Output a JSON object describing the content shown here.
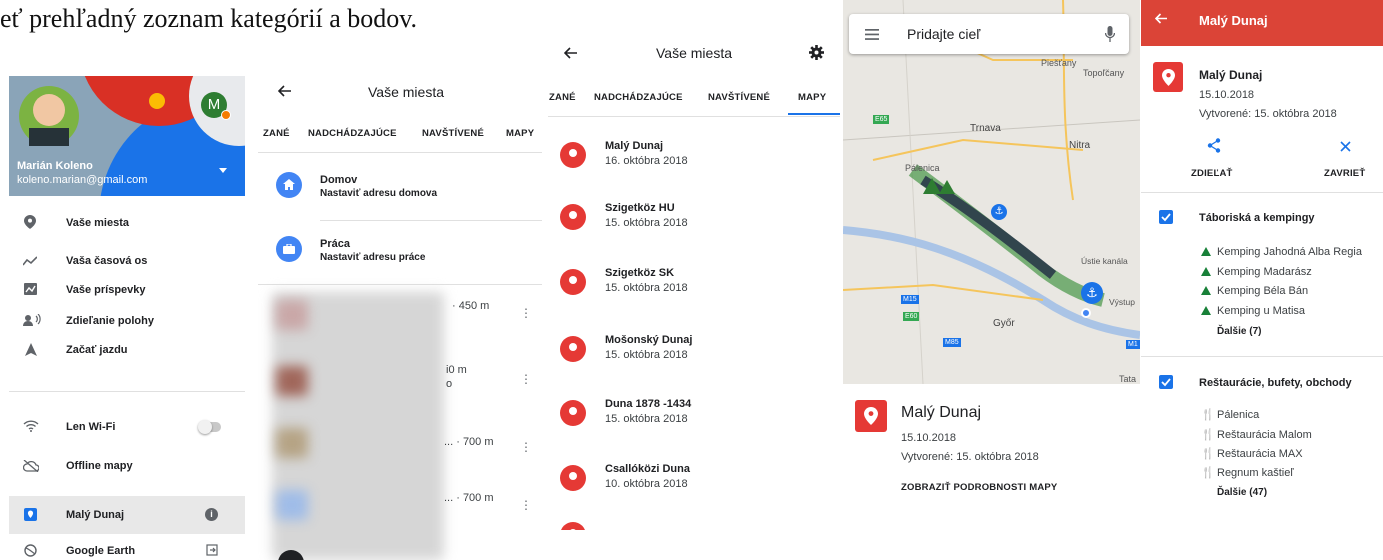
{
  "heading": {
    "text": "eť prehľadný zoznam kategórií a bodov."
  },
  "panel1": {
    "user_name": "Marián Koleno",
    "user_email": "koleno.marian@gmail.com",
    "avatar_letter": "M",
    "menu": [
      {
        "label": "Vaše miesta",
        "icon": "place-icon"
      },
      {
        "label": "Vaša časová os",
        "icon": "timeline-icon"
      },
      {
        "label": "Vaše príspevky",
        "icon": "contributions-icon"
      },
      {
        "label": "Zdieľanie polohy",
        "icon": "location-sharing-icon"
      },
      {
        "label": "Začať jazdu",
        "icon": "navigation-icon"
      }
    ],
    "menu2": [
      {
        "label": "Len Wi-Fi",
        "icon": "wifi-icon"
      },
      {
        "label": "Offline mapy",
        "icon": "cloud-off-icon"
      }
    ],
    "current_map": "Malý Dunaj",
    "earth": "Google Earth"
  },
  "panel2": {
    "title": "Vaše miesta",
    "tabs": [
      "ZANÉ",
      "NADCHÁDZAJÚCE",
      "NAVŠTÍVENÉ",
      "MAPY"
    ],
    "home_title": "Domov",
    "home_sub": "Nastaviť adresu domova",
    "work_title": "Práca",
    "work_sub": "Nastaviť adresu práce",
    "rows": [
      {
        "dist": "· 450 m",
        "extra": ""
      },
      {
        "dist": "i0 m",
        "extra": "o"
      },
      {
        "dist": "... · 700 m",
        "extra": ""
      },
      {
        "dist": "... · 700 m",
        "extra": ""
      }
    ]
  },
  "panel3": {
    "title": "Vaše miesta",
    "tabs": [
      "ZANÉ",
      "NADCHÁDZAJÚCE",
      "NAVŠTÍVENÉ",
      "MAPY"
    ],
    "maps": [
      {
        "name": "Malý Dunaj",
        "date": "16. októbra 2018"
      },
      {
        "name": "Szigetköz HU",
        "date": "15. októbra 2018"
      },
      {
        "name": "Szigetköz SK",
        "date": "15. októbra 2018"
      },
      {
        "name": "Mošonský Dunaj",
        "date": "15. októbra 2018"
      },
      {
        "name": "Duna 1878 -1434",
        "date": "15. októbra 2018"
      },
      {
        "name": "Csallóközi Duna",
        "date": "10. októbra 2018"
      }
    ]
  },
  "panel4": {
    "search_placeholder": "Pridajte cieľ",
    "map_labels": [
      "Piešťany",
      "Topoľčany",
      "Trnava",
      "Nitra",
      "Pálenica",
      "Ústie kanála",
      "Győr",
      "Výstup",
      "Tata",
      "M15",
      "E65",
      "M1",
      "M85",
      "E60"
    ],
    "map_title": "Malý Dunaj",
    "map_date": "15.10.2018",
    "map_created": "Vytvorené: 15. októbra 2018",
    "details_link": "ZOBRAZIŤ PODROBNOSTI MAPY"
  },
  "panel5": {
    "header": "Malý Dunaj",
    "title": "Malý Dunaj",
    "date": "15.10.2018",
    "created": "Vytvorené: 15. októbra 2018",
    "share": "ZDIEĽAŤ",
    "close": "ZAVRIEŤ",
    "cat1": "Táboriská a kempingy",
    "cat1_items": [
      "Kemping Jahodná Alba Regia",
      "Kemping Madarász",
      "Kemping Béla Bán",
      "Kemping u Matisa"
    ],
    "cat1_more": "Ďalšie (7)",
    "cat2": "Reštaurácie, bufety, obchody",
    "cat2_items": [
      "Pálenica",
      "Reštaurácia Malom",
      "Reštaurácia MAX",
      "Regnum kaštieľ"
    ],
    "cat2_more": "Ďalšie (47)"
  },
  "colors": {
    "accent_red": "#e53935",
    "accent_blue": "#1a73e8",
    "header_red": "#db4437"
  }
}
